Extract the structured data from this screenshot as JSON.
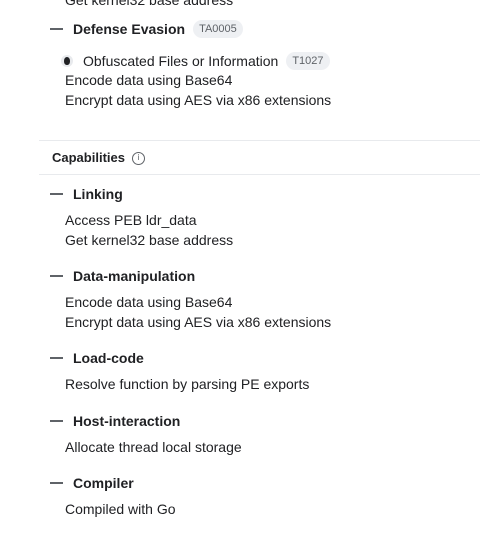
{
  "clipped_top_text": "Get kernel32 base address",
  "defense_evasion": {
    "title": "Defense Evasion",
    "tag": "TA0005",
    "technique": {
      "icon": "eye-dot-icon",
      "name": "Obfuscated Files or Information",
      "tag": "T1027"
    },
    "items": [
      "Encode data using Base64",
      "Encrypt data using AES via x86 extensions"
    ]
  },
  "capabilities": {
    "title": "Capabilities",
    "info_icon": "info-icon",
    "groups": [
      {
        "title": "Linking",
        "items": [
          "Access PEB ldr_data",
          "Get kernel32 base address"
        ]
      },
      {
        "title": "Data-manipulation",
        "items": [
          "Encode data using Base64",
          "Encrypt data using AES via x86 extensions"
        ]
      },
      {
        "title": "Load-code",
        "items": [
          "Resolve function by parsing PE exports"
        ]
      },
      {
        "title": "Host-interaction",
        "items": [
          "Allocate thread local storage"
        ]
      },
      {
        "title": "Compiler",
        "items": [
          "Compiled with Go"
        ]
      }
    ]
  },
  "colors": {
    "text": "#202124",
    "muted": "#5f6368",
    "tag_bg": "#eef0f3",
    "divider": "#e8eaed"
  }
}
